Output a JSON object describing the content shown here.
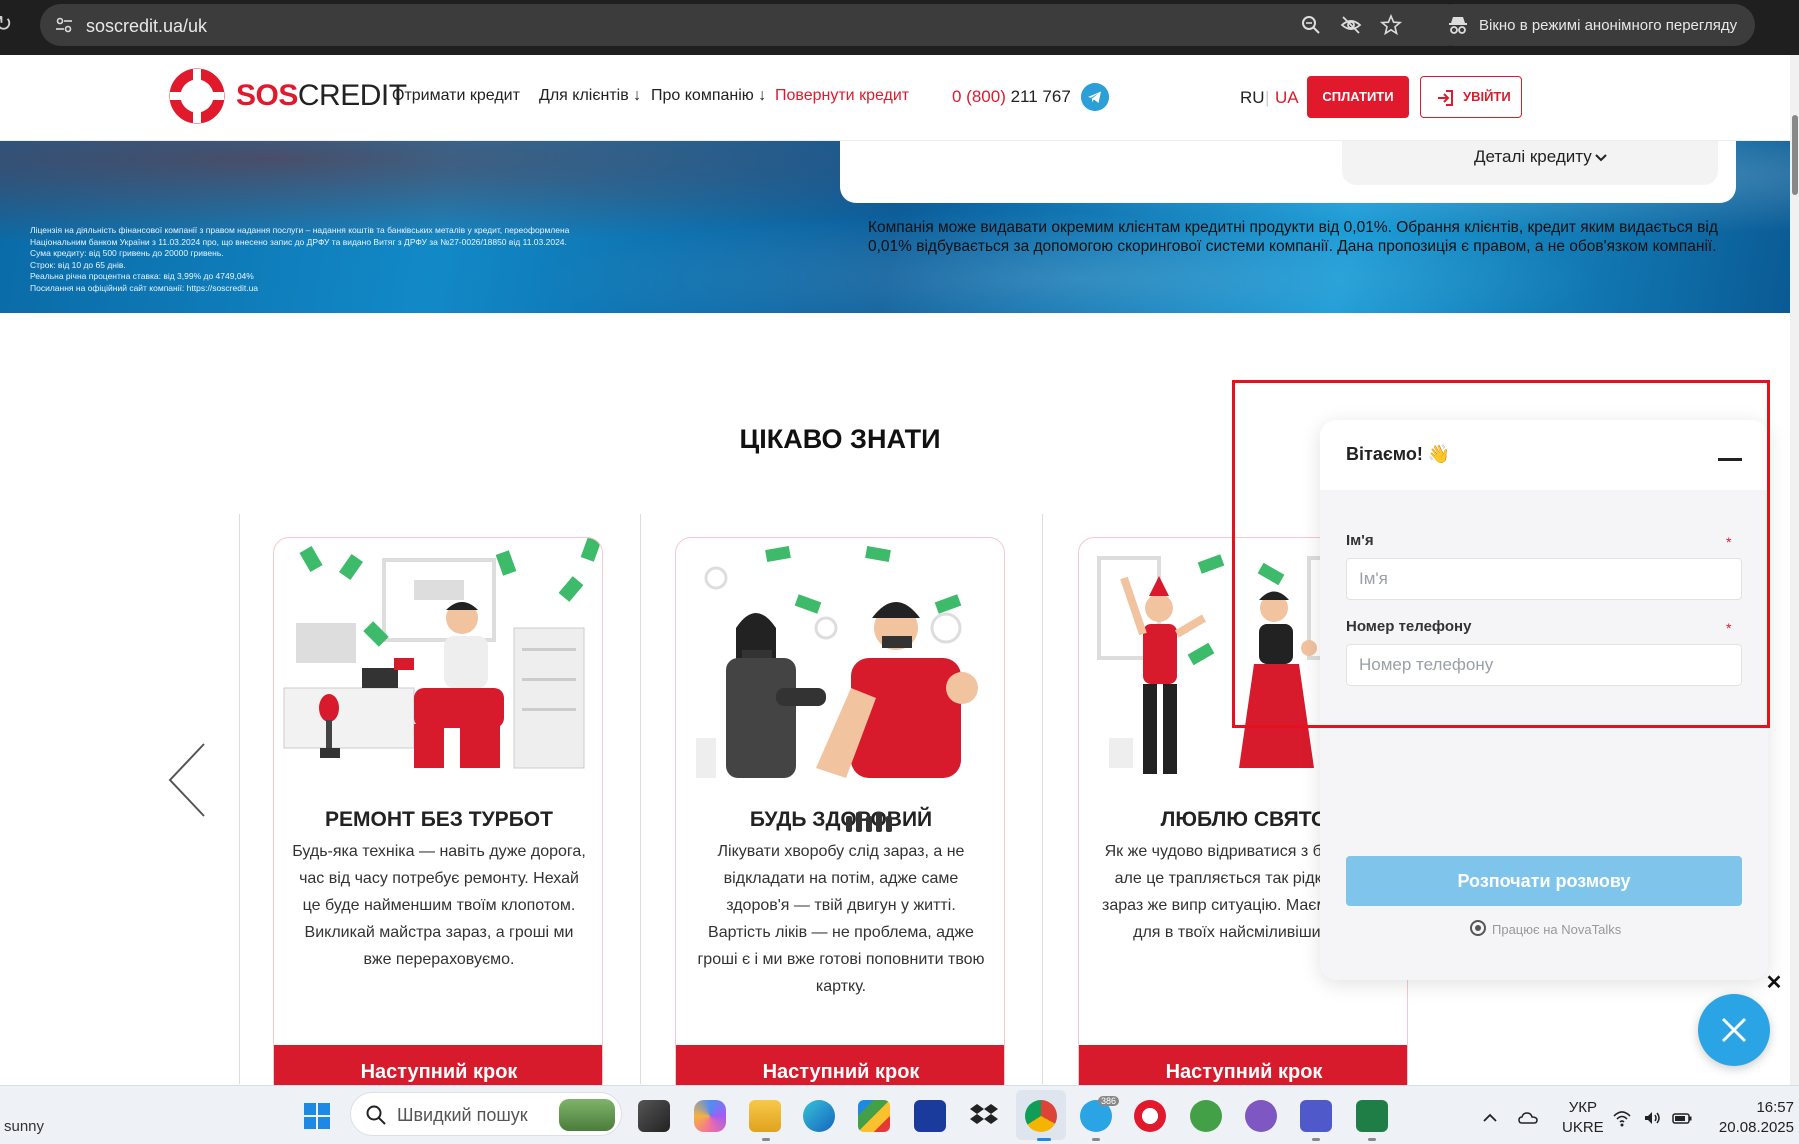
{
  "browser": {
    "url": "soscredit.ua/uk",
    "incognito_label": "Вікно в режимі анонімного перегляду"
  },
  "header": {
    "logo_sos": "SOS",
    "logo_credit": "CREDIT",
    "nav": [
      {
        "label": "Отримати кредит"
      },
      {
        "label": "Для клієнтів ↓"
      },
      {
        "label": "Про компанію ↓"
      },
      {
        "label": "Повернути кредит"
      }
    ],
    "phone_code": "0 (800)",
    "phone_number": " 211 767",
    "lang_ru": "RU",
    "lang_sep": "|",
    "lang_ua": "UA",
    "pay_label": "СПЛАТИТИ",
    "login_label": "УВІЙТИ"
  },
  "hero": {
    "details_label": "Деталі кредиту",
    "license_lines": [
      "Ліцензія на діяльність фінансової компанії з правом надання послуги – надання коштів та банківських металів у кредит, переоформлена",
      "Національним банком України з 11.03.2024 про, що внесено запис до ДРФУ та видано Витяг з ДРФУ за №27-0026/18850 від 11.03.2024.",
      "Сума кредиту: від 500 гривень до 20000 гривень.",
      "Строк: від 10 до 65 днів.",
      "Реальна річна процентна ставка: від 3,99% до 4749,04%",
      "Посилання на офіційний сайт компанії: https://soscredit.ua"
    ],
    "note": "Компанія може видавати окремим клієнтам кредитні продукти від 0,01%. Обрання клієнтів, кредит яким видається від 0,01% відбувається за допомогою скорингової системи компанії. Дана пропозиція є правом, а не обов'язком компанії."
  },
  "section": {
    "title": "ЦІКАВО ЗНАТИ",
    "cards": [
      {
        "title": "РЕМОНТ БЕЗ ТУРБОТ",
        "text": "Будь-яка техніка — навіть дуже дорога, час від часу потребує ремонту. Нехай це буде найменшим твоїм клопотом. Викликай майстра зараз, а гроші ми вже перераховуємо.",
        "button": "Наступний крок"
      },
      {
        "title": "БУДЬ ЗДОРОВИЙ",
        "text": "Лікувати хворобу слід зараз, а не відкладати на потім, адже саме здоров'я — твій двигун у житті. Вартість ліків — не проблема, адже гроші є і ми вже готові поповнити твою картку.",
        "button": "Наступний крок"
      },
      {
        "title": "ЛЮБЛЮ СВЯТО",
        "text": "Як же чудово відриватися з близьких, але це трапляється так рідко! Слід зараз же випр ситуацію. Маємо кошти для в твоїх найсміливіших іде",
        "button": "Наступний крок"
      }
    ]
  },
  "chat": {
    "greeting": "Вітаємо! 👋",
    "name_label": "Ім'я",
    "name_placeholder": "Ім'я",
    "phone_label": "Номер телефону",
    "phone_placeholder": "Номер телефону",
    "required_mark": "*",
    "start_label": "Розпочати розмову",
    "powered": "Працює на NovaTalks",
    "close_mark": "✕"
  },
  "taskbar": {
    "weather": "sunny",
    "search_placeholder": "Швидкий пошук",
    "telegram_badge": "386",
    "lang_line1": "УКР",
    "lang_line2": "UKRE",
    "time": "16:57",
    "date": "20.08.2025"
  },
  "colors": {
    "brand_red": "#e01a2c",
    "chat_blue": "#2aa4e4",
    "start_button": "#7fc4ea"
  }
}
